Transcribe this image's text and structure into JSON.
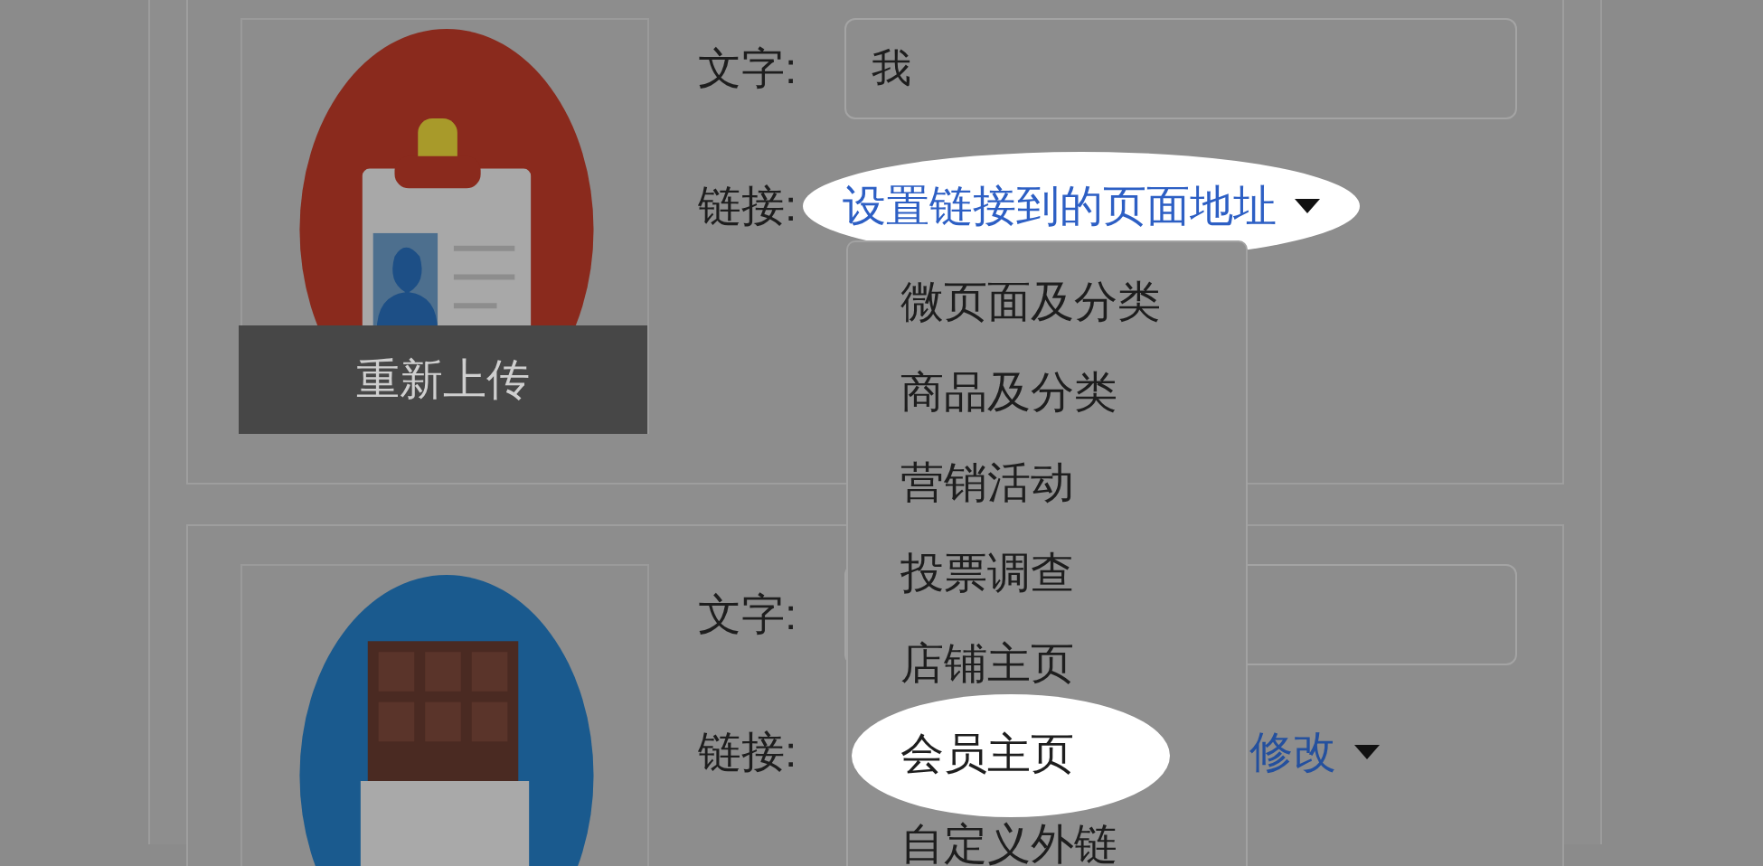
{
  "cards": [
    {
      "image": {
        "kind": "badge",
        "overlay_label": "重新上传"
      },
      "text_label": "文字:",
      "text_value": "我",
      "link_label": "链接:",
      "link_value": "设置链接到的页面地址",
      "link_highlighted": true
    },
    {
      "image": {
        "kind": "chocolate"
      },
      "text_label": "文字:",
      "link_label": "链接:",
      "link_value": "修改",
      "link_highlighted": false
    }
  ],
  "link_menu": {
    "items": [
      {
        "label": "微页面及分类",
        "selected": false
      },
      {
        "label": "商品及分类",
        "selected": false
      },
      {
        "label": "营销活动",
        "selected": false
      },
      {
        "label": "投票调查",
        "selected": false
      },
      {
        "label": "店铺主页",
        "selected": false
      },
      {
        "label": "会员主页",
        "selected": true
      },
      {
        "label": "自定义外链",
        "selected": false
      }
    ]
  }
}
